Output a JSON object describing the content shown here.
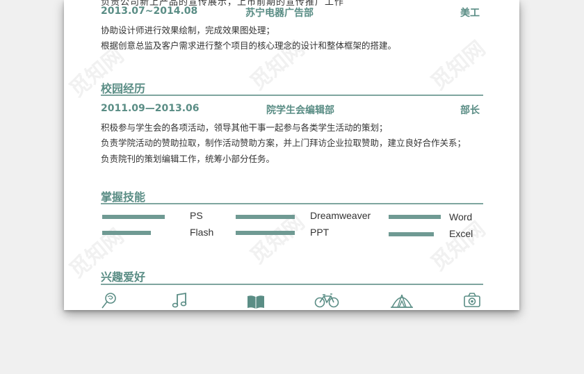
{
  "work": {
    "cut_text": "负责公司新上产品的宣传展示，上市前期的宣传推广工作",
    "date": "2013.07~2014.08",
    "org": "苏宁电器广告部",
    "role": "美工",
    "desc": [
      "协助设计师进行效果绘制，完成效果图处理；",
      "根据创意总监及客户需求进行整个项目的核心理念的设计和整体框架的搭建。"
    ]
  },
  "campus": {
    "title": "校园经历",
    "date": "2011.09—2013.06",
    "org": "院学生会编辑部",
    "role": "部长",
    "desc": [
      "积极参与学生会的各项活动，领导其他干事一起参与各类学生活动的策划；",
      "负责学院活动的赞助拉取，制作活动赞助方案，并上门拜访企业拉取赞助，建立良好合作关系；",
      "负责院刊的策划编辑工作，统筹小部分任务。"
    ]
  },
  "skills": {
    "title": "掌握技能",
    "items": [
      {
        "name": "PS",
        "level": 0.9
      },
      {
        "name": "Flash",
        "level": 0.7
      },
      {
        "name": "Dreamweaver",
        "level": 0.85
      },
      {
        "name": "PPT",
        "level": 0.85
      },
      {
        "name": "Word",
        "level": 0.75
      },
      {
        "name": "Excel",
        "level": 0.65
      }
    ]
  },
  "hobbies": {
    "title": "兴趣爱好",
    "icons": [
      "lollipop-icon",
      "music-note-icon",
      "book-icon",
      "bicycle-icon",
      "tent-icon",
      "camera-icon"
    ]
  },
  "watermark": "觅知网",
  "colors": {
    "accent": "#5a8d85",
    "bar": "#6f9a93",
    "line": "#7ea59f"
  }
}
